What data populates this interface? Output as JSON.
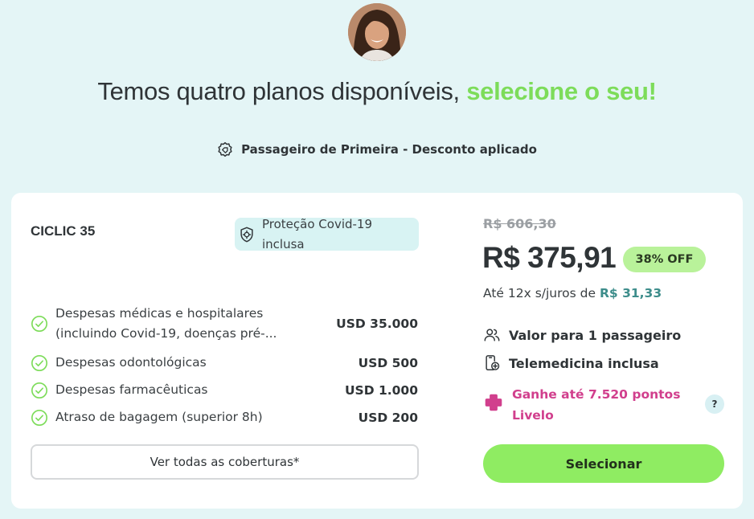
{
  "header": {
    "title_main": "Temos quatro planos disponíveis,",
    "title_accent": "selecione o seu!",
    "discount_label": "Passageiro de Primeira - Desconto aplicado"
  },
  "plan": {
    "name": "CICLIC 35",
    "covid_badge": "Proteção Covid-19 inclusa",
    "coverages": [
      {
        "label": "Despesas médicas e hospitalares (incluindo Covid-19, doenças pré-...",
        "value": "USD 35.000"
      },
      {
        "label": "Despesas odontológicas",
        "value": "USD 500"
      },
      {
        "label": "Despesas farmacêuticas",
        "value": "USD 1.000"
      },
      {
        "label": "Atraso de bagagem (superior 8h)",
        "value": "USD 200"
      }
    ],
    "all_coverages_button": "Ver todas as coberturas*",
    "old_price": "R$ 606,30",
    "price": "R$ 375,91",
    "off_badge": "38% OFF",
    "installments_prefix": "Até 12x s/juros de",
    "installments_value": "R$ 31,33",
    "passengers": "Valor para 1 passageiro",
    "telemedicine": "Telemedicina inclusa",
    "livelo": "Ganhe até 7.520 pontos Livelo",
    "help": "?",
    "select_button": "Selecionar"
  },
  "colors": {
    "background": "#e4f5f6",
    "accent_green": "#7ddc5a",
    "button_green": "#8fec62",
    "livelo_pink": "#d13f8d",
    "installment_teal": "#3d8d8b"
  }
}
